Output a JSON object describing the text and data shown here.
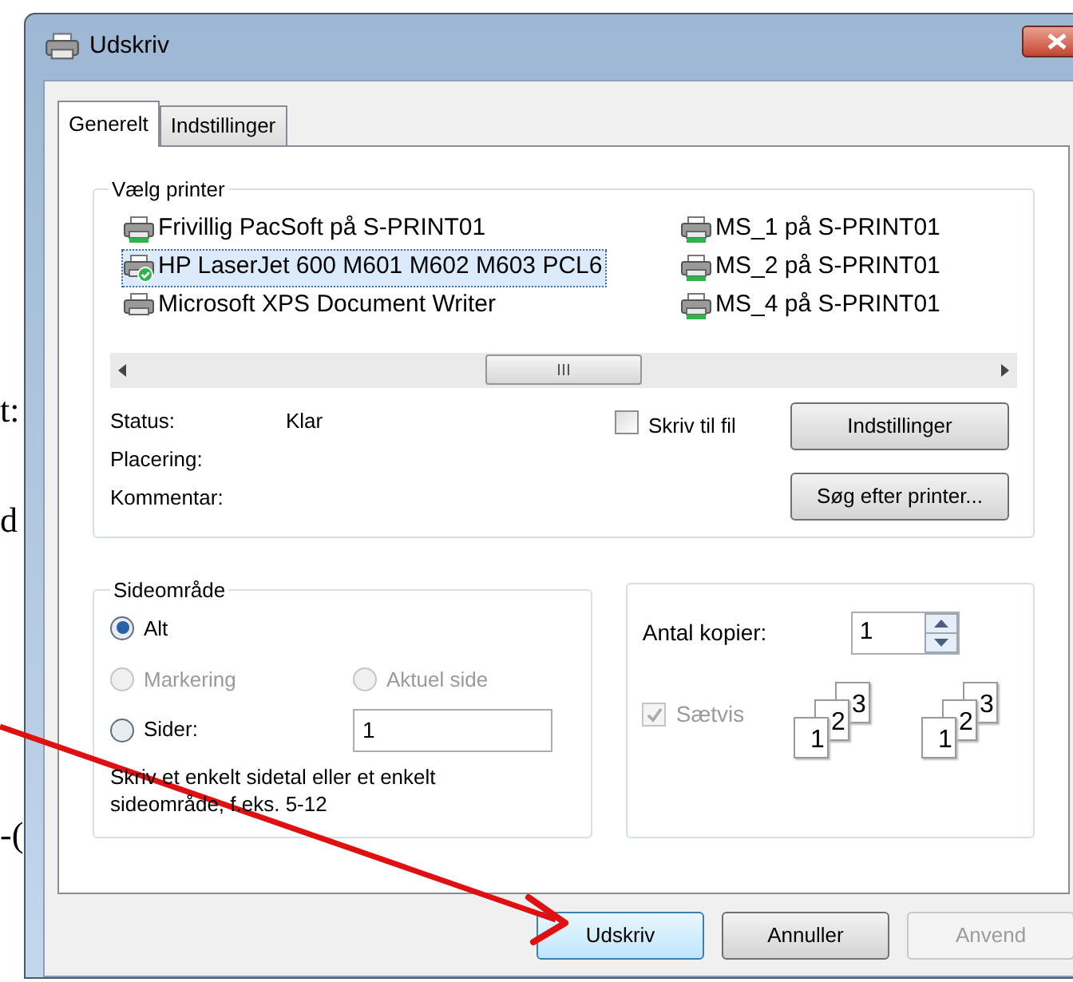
{
  "background_text": [
    "t:",
    "d",
    "-("
  ],
  "window": {
    "title": "Udskriv"
  },
  "tabs": [
    {
      "label": "Generelt",
      "selected": true
    },
    {
      "label": "Indstillinger",
      "selected": false
    }
  ],
  "printer_group": {
    "title": "Vælg printer",
    "printers": [
      {
        "name": "Frivillig PacSoft på S-PRINT01",
        "network": true,
        "default": false,
        "selected": false
      },
      {
        "name": "HP LaserJet 600 M601 M602 M603 PCL6",
        "network": false,
        "default": true,
        "selected": true
      },
      {
        "name": "Microsoft XPS Document Writer",
        "network": false,
        "default": false,
        "selected": false
      },
      {
        "name": "MS_1 på S-PRINT01",
        "network": true,
        "default": false,
        "selected": false
      },
      {
        "name": "MS_2 på S-PRINT01",
        "network": true,
        "default": false,
        "selected": false
      },
      {
        "name": "MS_4 på S-PRINT01",
        "network": true,
        "default": false,
        "selected": false
      }
    ],
    "info": [
      {
        "label": "Status:",
        "value": "Klar"
      },
      {
        "label": "Placering:"
      },
      {
        "label": "Kommentar:"
      }
    ],
    "print_to_file": {
      "label": "Skriv til fil",
      "checked": false
    },
    "buttons": [
      "Indstillinger",
      "Søg efter printer..."
    ]
  },
  "page_range": {
    "title": "Sideområde",
    "options": [
      {
        "label": "Alt",
        "selected": true,
        "disabled": false
      },
      {
        "label": "Markering",
        "selected": false,
        "disabled": true
      },
      {
        "label": "Aktuel side",
        "selected": false,
        "disabled": true
      },
      {
        "label": "Sider:",
        "selected": false,
        "disabled": false
      }
    ],
    "pages_value": "1",
    "hint": "Skriv et enkelt sidetal eller et enkelt sideområde, f.eks. 5-12"
  },
  "copies": {
    "label": "Antal kopier:",
    "value": "1",
    "collate": {
      "label": "Sætvis",
      "checked": true,
      "disabled": true
    },
    "illustrations": [
      [
        "1",
        "2",
        "3"
      ],
      [
        "1",
        "2",
        "3"
      ]
    ]
  },
  "buttons": [
    {
      "label": "Udskriv",
      "default": true,
      "disabled": false
    },
    {
      "label": "Annuller",
      "default": false,
      "disabled": false
    },
    {
      "label": "Anvend",
      "default": false,
      "disabled": true
    }
  ]
}
